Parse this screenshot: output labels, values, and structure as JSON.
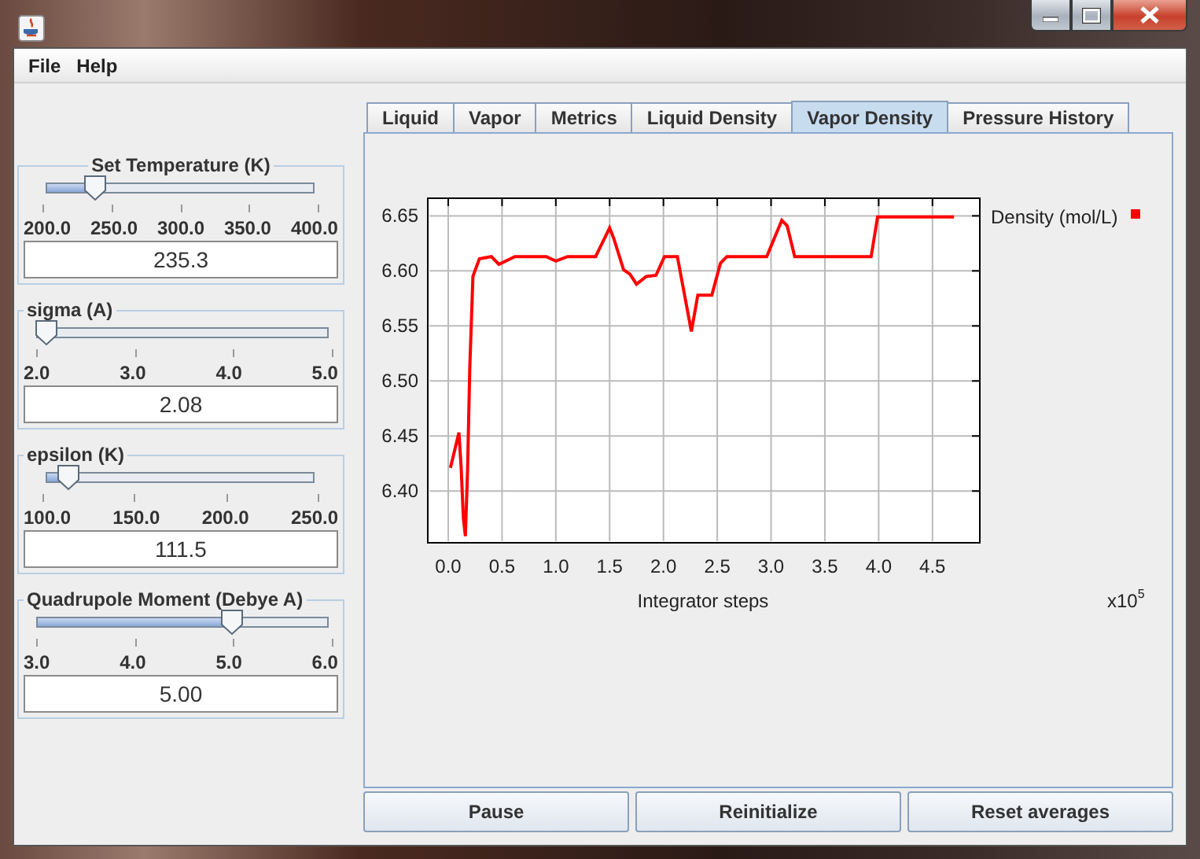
{
  "menu": [
    "File",
    "Help"
  ],
  "controls": [
    {
      "title": "Set Temperature (K)",
      "level": 0.177,
      "ticks": [
        "200.0",
        "250.0",
        "300.0",
        "350.0",
        "400.0"
      ],
      "value": "235.3",
      "title_centered": true
    },
    {
      "title": "sigma (A)",
      "level": 0.027,
      "ticks": [
        "2.0",
        "3.0",
        "4.0",
        "5.0"
      ],
      "value": "2.08",
      "title_centered": false
    },
    {
      "title": "epsilon (K)",
      "level": 0.077,
      "ticks": [
        "100.0",
        "150.0",
        "200.0",
        "250.0"
      ],
      "value": "111.5",
      "title_centered": false
    },
    {
      "title": "Quadrupole Moment (Debye A)",
      "level": 0.667,
      "ticks": [
        "3.0",
        "4.0",
        "5.0",
        "6.0"
      ],
      "value": "5.00",
      "title_centered": false
    }
  ],
  "tabs": [
    {
      "label": "Liquid",
      "selected": false
    },
    {
      "label": "Vapor",
      "selected": false
    },
    {
      "label": "Metrics",
      "selected": false
    },
    {
      "label": "Liquid Density",
      "selected": false
    },
    {
      "label": "Vapor Density",
      "selected": true
    },
    {
      "label": "Pressure History",
      "selected": false
    }
  ],
  "chart": {
    "multiplier": "x10",
    "exponent": "5",
    "chart_data": {
      "type": "line",
      "grid": true,
      "xlabel": "Integrator steps",
      "xlim": [
        -0.19,
        4.94
      ],
      "ylim": [
        6.353,
        6.666
      ],
      "xticks": [
        {
          "value": 0,
          "label": "0.0"
        },
        {
          "value": 0.5,
          "label": "0.5"
        },
        {
          "value": 1,
          "label": "1.0"
        },
        {
          "value": 1.5,
          "label": "1.5"
        },
        {
          "value": 2,
          "label": "2.0"
        },
        {
          "value": 2.5,
          "label": "2.5"
        },
        {
          "value": 3,
          "label": "3.0"
        },
        {
          "value": 3.5,
          "label": "3.5"
        },
        {
          "value": 4,
          "label": "4.0"
        },
        {
          "value": 4.5,
          "label": "4.5"
        }
      ],
      "yticks": [
        {
          "value": 6.4,
          "label": "6.40"
        },
        {
          "value": 6.45,
          "label": "6.45"
        },
        {
          "value": 6.5,
          "label": "6.50"
        },
        {
          "value": 6.55,
          "label": "6.55"
        },
        {
          "value": 6.6,
          "label": "6.60"
        },
        {
          "value": 6.65,
          "label": "6.65"
        }
      ],
      "x": [
        0.02,
        0.1,
        0.12,
        0.14,
        0.16,
        0.18,
        0.2,
        0.23,
        0.29,
        0.4,
        0.47,
        0.62,
        0.91,
        1.0,
        1.11,
        1.37,
        1.5,
        1.54,
        1.63,
        1.69,
        1.75,
        1.84,
        1.93,
        2.01,
        2.13,
        2.26,
        2.32,
        2.45,
        2.53,
        2.59,
        2.96,
        3.1,
        3.15,
        3.22,
        3.93,
        3.99,
        4.7
      ],
      "series": [
        {
          "name": "Density (mol/L)",
          "color": "#ff0000",
          "values": [
            6.421,
            6.453,
            6.422,
            6.376,
            6.359,
            6.419,
            6.512,
            6.595,
            6.611,
            6.613,
            6.606,
            6.613,
            6.613,
            6.609,
            6.613,
            6.613,
            6.639,
            6.629,
            6.601,
            6.597,
            6.588,
            6.595,
            6.596,
            6.613,
            6.613,
            6.545,
            6.578,
            6.578,
            6.607,
            6.613,
            6.613,
            6.646,
            6.641,
            6.613,
            6.613,
            6.649,
            6.649
          ]
        }
      ]
    }
  },
  "buttons": [
    "Pause",
    "Reinitialize",
    "Reset averages"
  ]
}
